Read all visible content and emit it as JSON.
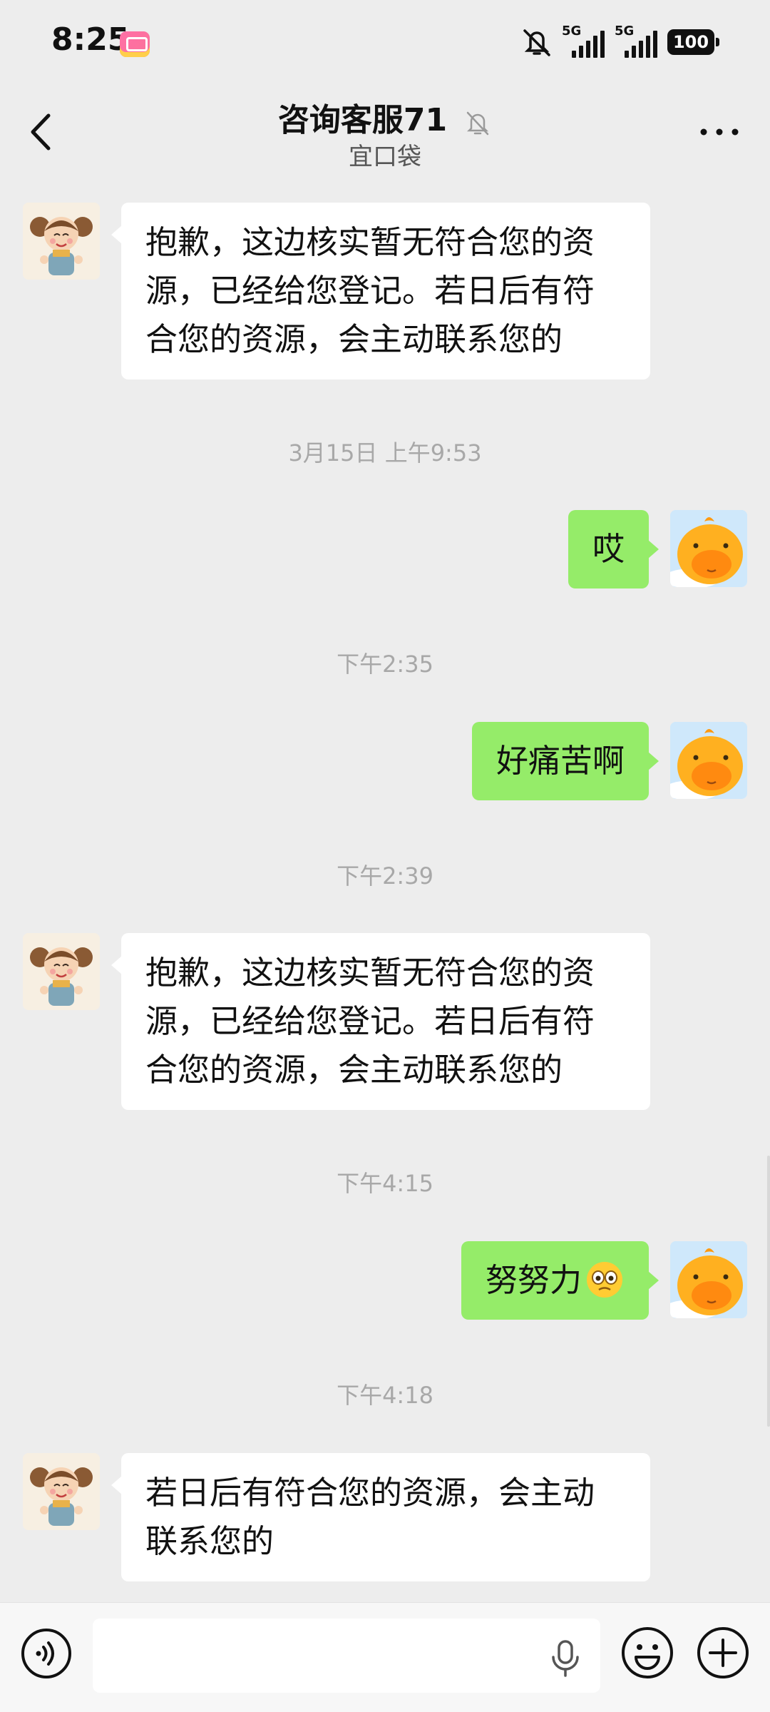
{
  "status_bar": {
    "time": "8:25",
    "network_label_1": "5G",
    "network_label_2": "5G",
    "battery": "100"
  },
  "nav": {
    "title": "咨询客服71",
    "subtitle": "宜口袋"
  },
  "messages": [
    {
      "side": "in",
      "text": "抱歉，这边核实暂无符合您的资源，已经给您登记。若日后有符合您的资源，会主动联系您的"
    },
    {
      "type": "time",
      "text": "3月15日 上午9:53"
    },
    {
      "side": "out",
      "text": "哎"
    },
    {
      "type": "time",
      "text": "下午2:35"
    },
    {
      "side": "out",
      "text": "好痛苦啊"
    },
    {
      "type": "time",
      "text": "下午2:39"
    },
    {
      "side": "in",
      "text": "抱歉，这边核实暂无符合您的资源，已经给您登记。若日后有符合您的资源，会主动联系您的"
    },
    {
      "type": "time",
      "text": "下午4:15"
    },
    {
      "side": "out",
      "text": "努努力",
      "emoji": "holding-back-tears-emoji"
    },
    {
      "type": "time",
      "text": "下午4:18"
    },
    {
      "side": "in",
      "text": "若日后有符合您的资源，会主动联系您的"
    }
  ],
  "icons": {
    "back": "chevron-left-icon",
    "mute": "bell-off-icon",
    "more": "more-dots-icon",
    "voice": "voice-mode-icon",
    "mic": "microphone-icon",
    "emoji": "smiley-icon",
    "plus": "plus-circle-icon"
  },
  "colors": {
    "background": "#ededed",
    "outgoing_bubble": "#95ec69",
    "incoming_bubble": "#ffffff",
    "timestamp": "#a8a8a8"
  }
}
